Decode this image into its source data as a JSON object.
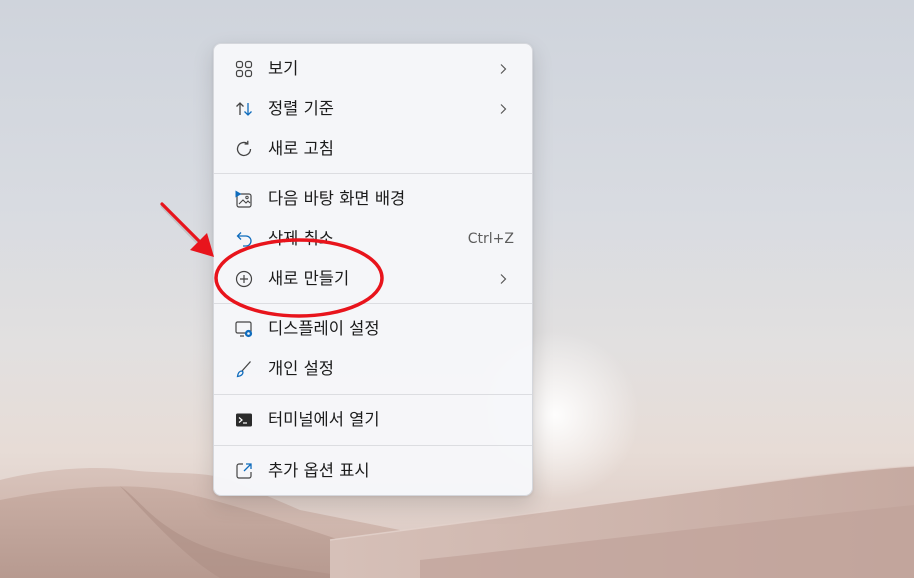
{
  "desktop": {
    "context_menu": {
      "items": [
        {
          "label": "보기",
          "icon": "grid-view-icon",
          "has_submenu": true
        },
        {
          "label": "정렬 기준",
          "icon": "sort-arrows-icon",
          "has_submenu": true
        },
        {
          "label": "새로 고침",
          "icon": "refresh-icon",
          "has_submenu": false
        },
        {
          "label": "다음 바탕 화면 배경",
          "icon": "next-background-icon",
          "has_submenu": false
        },
        {
          "label": "삭제 취소",
          "icon": "undo-icon",
          "shortcut": "Ctrl+Z",
          "has_submenu": false
        },
        {
          "label": "새로 만들기",
          "icon": "new-plus-icon",
          "has_submenu": true
        },
        {
          "label": "디스플레이 설정",
          "icon": "display-settings-icon",
          "has_submenu": false
        },
        {
          "label": "개인 설정",
          "icon": "brush-icon",
          "has_submenu": false
        },
        {
          "label": "터미널에서 열기",
          "icon": "terminal-icon",
          "has_submenu": false
        },
        {
          "label": "추가 옵션 표시",
          "icon": "more-options-icon",
          "has_submenu": false
        }
      ]
    },
    "annotation": {
      "highlight_color": "#e8141c",
      "highlighted_item": "새로 만들기"
    },
    "colors": {
      "accent": "#0f6cbd",
      "menu_bg": "#f6f7fa",
      "text": "#1b1b1b"
    }
  }
}
